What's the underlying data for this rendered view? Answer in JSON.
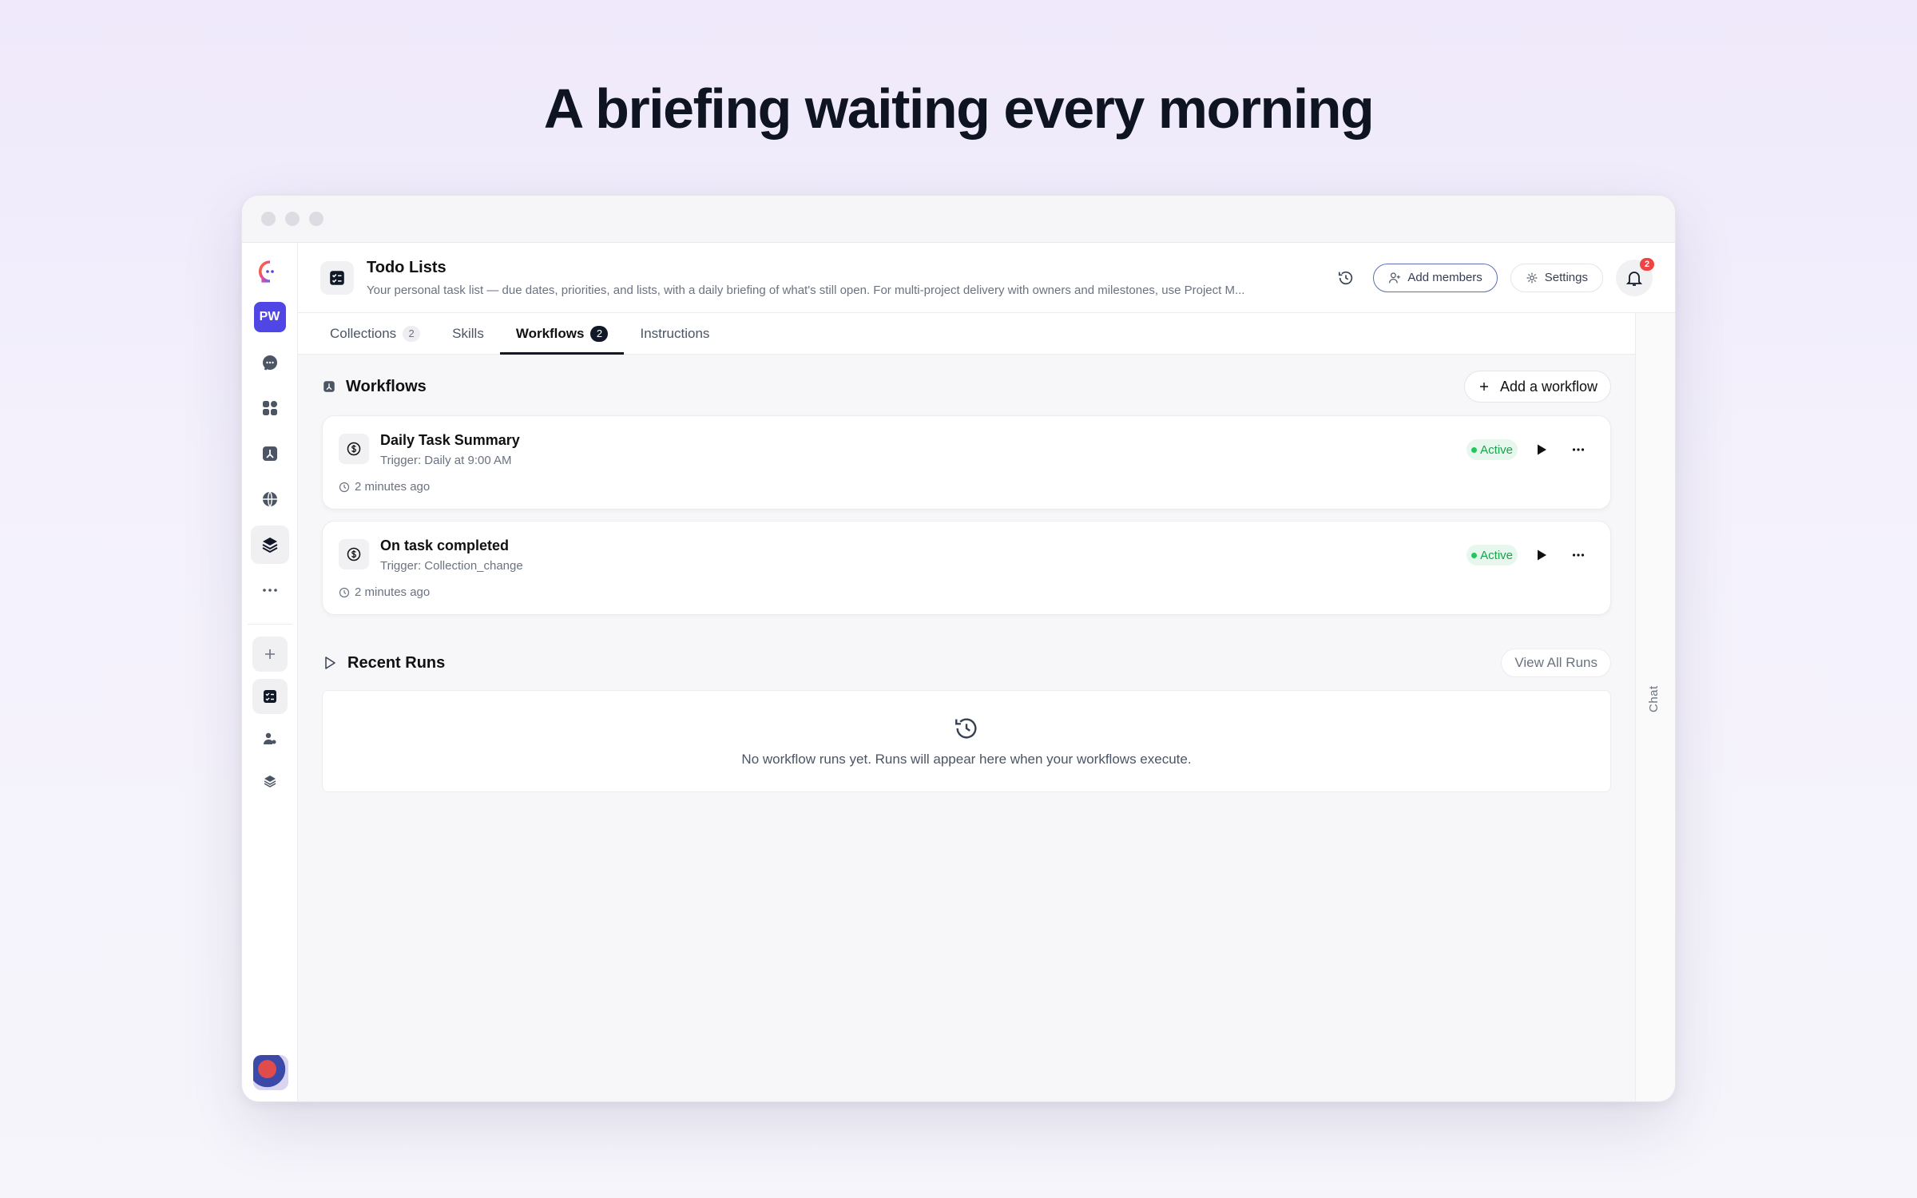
{
  "headline": "A briefing waiting every morning",
  "rail": {
    "workspace_initials": "PW",
    "items": [
      {
        "icon": "chat-icon"
      },
      {
        "icon": "apps-grid-icon"
      },
      {
        "icon": "workflow-icon"
      },
      {
        "icon": "globe-icon"
      },
      {
        "icon": "layers-icon"
      },
      {
        "icon": "more-icon"
      }
    ],
    "bottom_items": [
      {
        "icon": "plus-icon"
      },
      {
        "icon": "checklist-icon"
      },
      {
        "icon": "user-settings-icon"
      },
      {
        "icon": "stack-icon"
      }
    ]
  },
  "header": {
    "title": "Todo Lists",
    "description": "Your personal task list — due dates, priorities, and lists, with a daily briefing of what's still open. For multi-project delivery with owners and milestones, use Project M...",
    "add_members_label": "Add members",
    "settings_label": "Settings",
    "notification_count": "2"
  },
  "tabs": [
    {
      "label": "Collections",
      "count": "2",
      "active": false
    },
    {
      "label": "Skills",
      "count": "",
      "active": false
    },
    {
      "label": "Workflows",
      "count": "2",
      "active": true
    },
    {
      "label": "Instructions",
      "count": "",
      "active": false
    }
  ],
  "workflows": {
    "title": "Workflows",
    "add_label": "Add a workflow",
    "items": [
      {
        "name": "Daily Task Summary",
        "trigger": "Trigger: Daily at 9:00 AM",
        "time": "2 minutes ago",
        "status": "Active"
      },
      {
        "name": "On task completed",
        "trigger": "Trigger: Collection_change",
        "time": "2 minutes ago",
        "status": "Active"
      }
    ]
  },
  "recent_runs": {
    "title": "Recent Runs",
    "view_all_label": "View All Runs",
    "empty_text": "No workflow runs yet. Runs will appear here when your workflows execute."
  },
  "chat_label": "Chat",
  "colors": {
    "accent": "#4f46e5",
    "active_green": "#16a34a",
    "badge_red": "#ef4444"
  }
}
